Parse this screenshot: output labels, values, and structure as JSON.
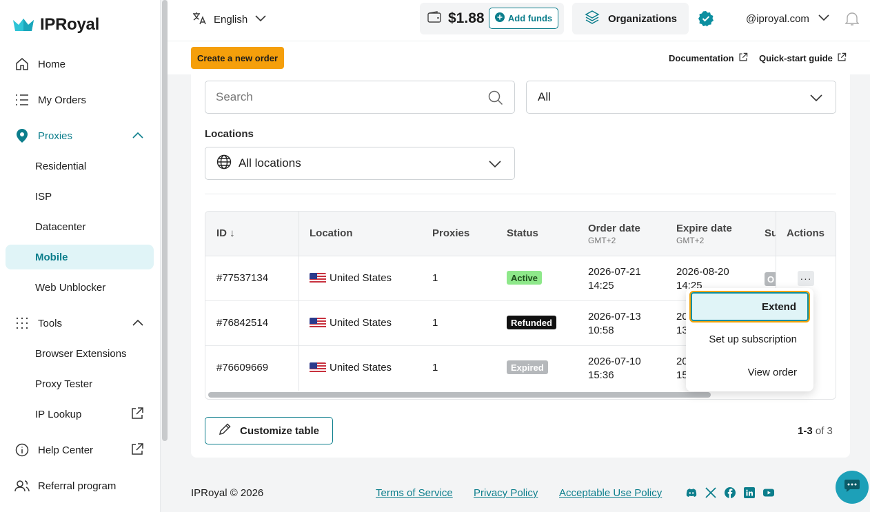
{
  "brand": {
    "name": "IPRoyal",
    "accent": "#0c7e8c",
    "warning": "#f59f0b"
  },
  "sidebar": {
    "items": [
      {
        "label": "Home",
        "icon": "home-icon"
      },
      {
        "label": "My Orders",
        "icon": "list-icon"
      },
      {
        "label": "Proxies",
        "icon": "location-pin-icon"
      },
      {
        "label": "Residential"
      },
      {
        "label": "ISP"
      },
      {
        "label": "Datacenter"
      },
      {
        "label": "Mobile"
      },
      {
        "label": "Web Unblocker"
      },
      {
        "label": "Tools",
        "icon": "grid-dots-icon"
      },
      {
        "label": "Browser Extensions"
      },
      {
        "label": "Proxy Tester"
      },
      {
        "label": "IP Lookup"
      },
      {
        "label": "Help Center",
        "icon": "info-icon"
      },
      {
        "label": "Referral program",
        "icon": "users-icon"
      }
    ]
  },
  "topbar": {
    "language": "English",
    "balance": "$1.88",
    "add_funds": "Add funds",
    "organizations": "Organizations",
    "account": "@iproyal.com"
  },
  "actions": {
    "create_order": "Create a new order",
    "documentation": "Documentation",
    "quick_start": "Quick-start guide"
  },
  "filters": {
    "search_placeholder": "Search",
    "status_value": "All",
    "locations_label": "Locations",
    "locations_value": "All locations"
  },
  "table": {
    "headers": {
      "id": "ID",
      "location": "Location",
      "proxies": "Proxies",
      "status": "Status",
      "order_date": "Order date",
      "order_date_tz": "GMT+2",
      "expire_date": "Expire date",
      "expire_date_tz": "GMT+2",
      "subscription": "Su",
      "actions": "Actions"
    },
    "rows": [
      {
        "id": "#77537134",
        "location": "United States",
        "proxies": "1",
        "status": "Active",
        "order_date": "2026-07-21",
        "order_time": "14:25",
        "expire_date": "2026-08-20",
        "expire_time": "14:25",
        "sub": "O"
      },
      {
        "id": "#76842514",
        "location": "United States",
        "proxies": "1",
        "status": "Refunded",
        "order_date": "2026-07-13",
        "order_time": "10:58",
        "expire_date": "20",
        "expire_time": "13"
      },
      {
        "id": "#76609669",
        "location": "United States",
        "proxies": "1",
        "status": "Expired",
        "order_date": "2026-07-10",
        "order_time": "15:36",
        "expire_date": "20",
        "expire_time": "15"
      }
    ],
    "status_colors": {
      "Active": "#8ee88a",
      "Refunded": "#111111",
      "Expired": "#b5b8bb"
    }
  },
  "menu": {
    "extend": "Extend",
    "subscription": "Set up subscription",
    "view_order": "View order"
  },
  "bottom": {
    "customize": "Customize table",
    "range": "1-3",
    "of": "of 3"
  },
  "footer": {
    "copyright": "IPRoyal © 2026",
    "terms": "Terms of Service",
    "privacy": "Privacy Policy",
    "aup": "Acceptable Use Policy"
  }
}
